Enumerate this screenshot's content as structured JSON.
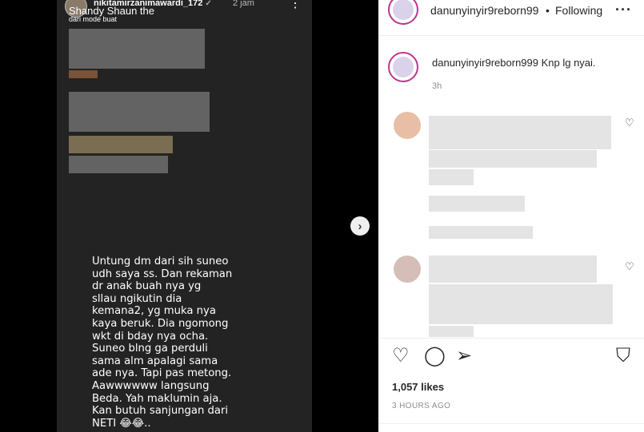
{
  "story": {
    "username": "nikitamirzanimawardi_172",
    "verified_mark": "✓",
    "time": "2 jam",
    "menu_icon": "⋮",
    "snippet_line1": "Shandy Shaun the",
    "snippet_line2": "dari mode buat",
    "body": "Untung dm dari sih suneo\nudh saya ss. Dan rekaman\ndr anak buah nya yg\nsllau ngikutin dia\nkemana2, yg muka nya\nkaya beruk. Dia ngomong\nwkt di bday nya ocha.\nSuneo blng ga perduli\nsama alm apalagi sama\nade nya. Tapi pas metong.\nAawwwwww langsung\nBeda. Yah maklumin aja.\nKan butuh sanjungan dari\nNETI 😂😂..",
    "next_icon": "›"
  },
  "header": {
    "username": "danunyinyir9reborn99",
    "separator": "•",
    "follow_label": "Following",
    "more_icon": "···"
  },
  "caption": {
    "username": "danunyinyir9reborn999",
    "text": "Knp lg nyai.",
    "time": "3h"
  },
  "comments": {
    "heart_icon": "♡"
  },
  "actions": {
    "like_icon": "♡",
    "comment_icon": "◯",
    "share_icon": "➢",
    "save_icon": "⛉"
  },
  "likes": "1,057 likes",
  "post_time": "3 HOURS AGO"
}
